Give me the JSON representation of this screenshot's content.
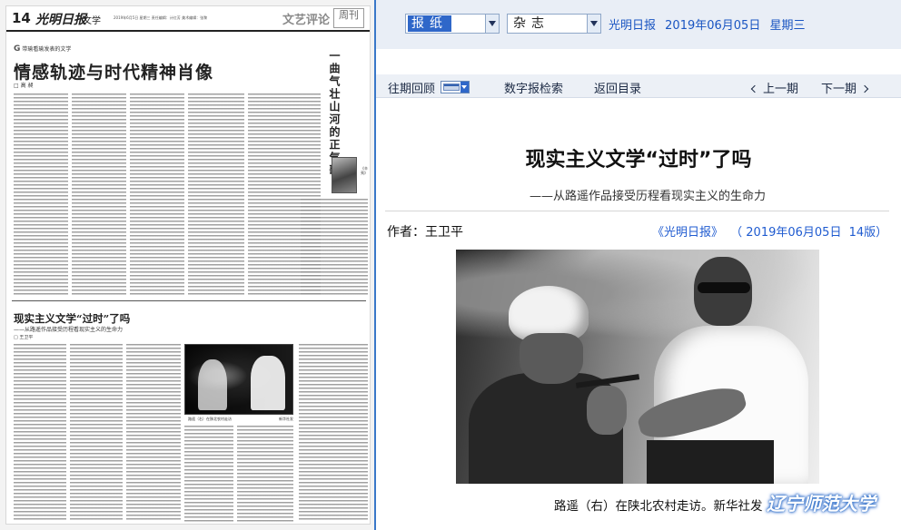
{
  "newspaper_page": {
    "page_number": "14",
    "paper_name": "光明日报",
    "section": "文学",
    "header_info": "2019年6月5日 星期三 责任编辑：计红芳 美术编辑：张黎",
    "column_title": "文艺评论",
    "column_week": "周刊",
    "tagline": "带瑜看瑜发表的文学",
    "tagline_mark": "G",
    "lead_headline": "情感轨迹与时代精神肖像",
    "lead_author": "□ 高 昶",
    "sidebar_headline": "一曲气壮山河的正气歌",
    "book_caption": "《辛夷》",
    "second_headline": "现实主义文学“过时”了吗",
    "second_subheadline": "——从路遥作品接受历程看现实主义的生命力",
    "second_author": "□ 王卫平",
    "photo_caption": "路遥（右）在陕北农村走访",
    "photo_credit": "新华社发"
  },
  "toolbar": {
    "type_select": "报纸",
    "magazine_select": "杂志",
    "paper_name": "光明日报",
    "date": "2019年06月05日",
    "weekday": "星期三"
  },
  "nav": {
    "history": "往期回顾",
    "digital_search": "数字报检索",
    "back_to_index": "返回目录",
    "prev_issue": "上一期",
    "next_issue": "下一期"
  },
  "article": {
    "title": "现实主义文学“过时”了吗",
    "subtitle": "——从路遥作品接受历程看现实主义的生命力",
    "author": "作者：王卫平",
    "source_paper": "《光明日报》",
    "source_date": "（ 2019年06月05日",
    "source_page": "14版）",
    "photo_caption": "路遥（右）在陕北农村走访。新华社发"
  },
  "watermark": "辽宁师范大学",
  "colors": {
    "link_blue": "#1f5bd0",
    "select_highlight": "#2f67c9",
    "panel_border": "#3a78c9",
    "toolbar_bg": "#e9eef6"
  }
}
